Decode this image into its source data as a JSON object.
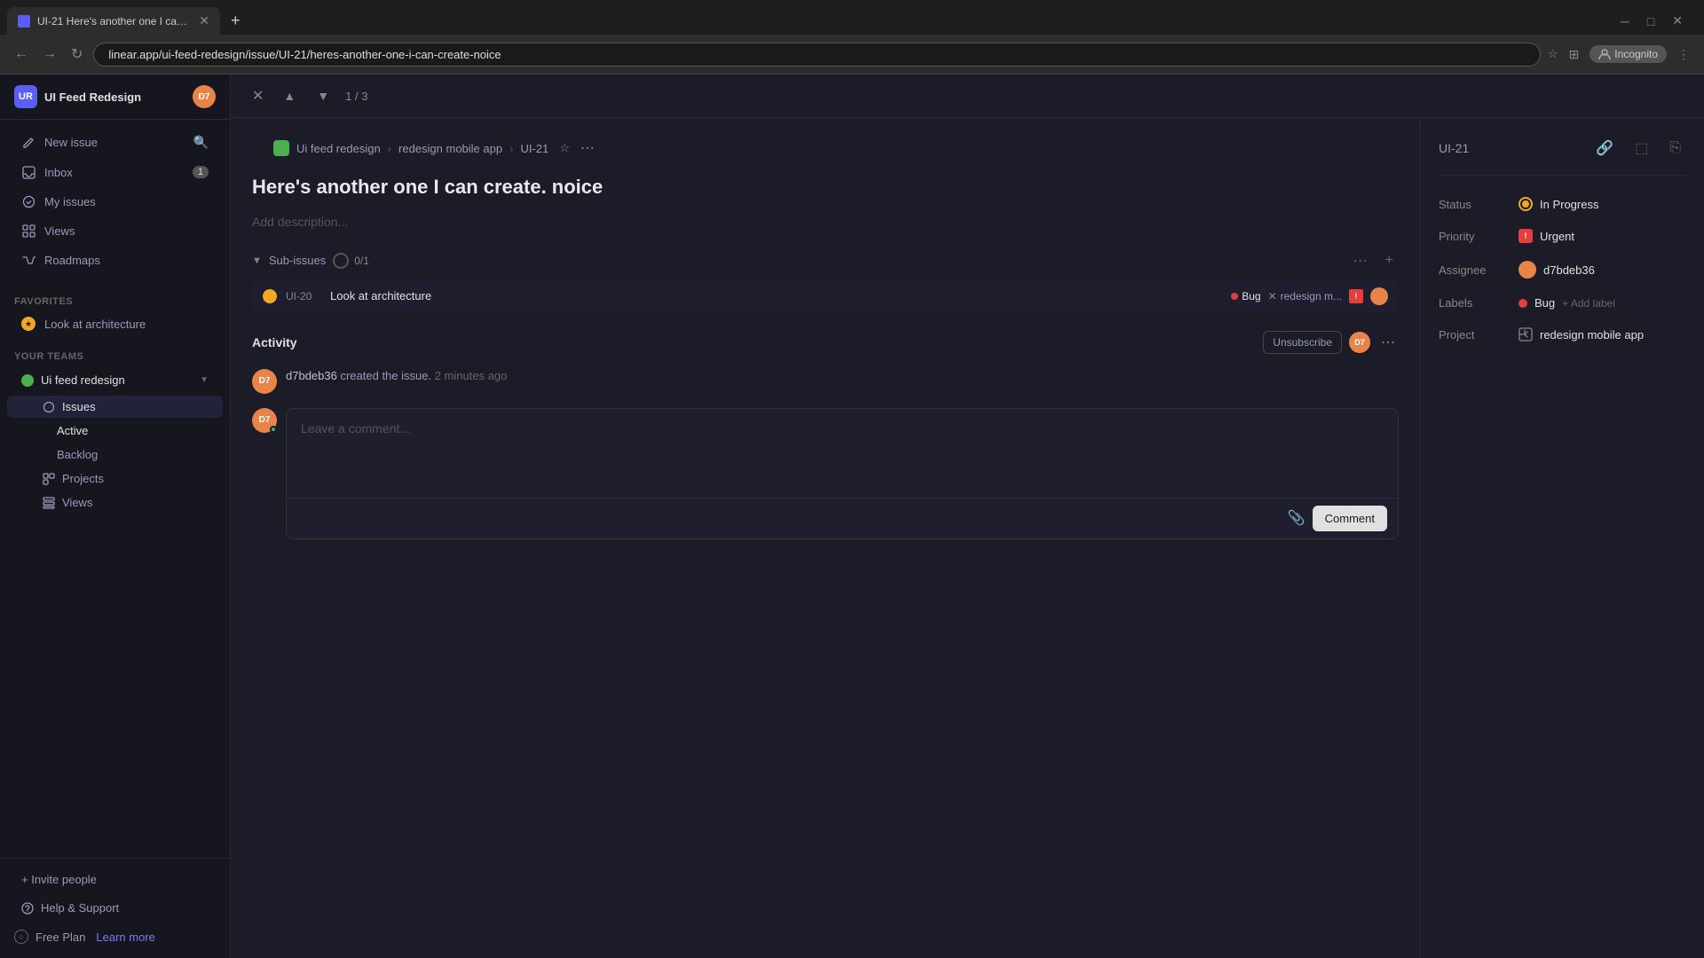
{
  "browser": {
    "tab_title": "UI-21 Here's another one I can c...",
    "tab_favicon": "U",
    "url": "linear.app/ui-feed-redesign/issue/UI-21/heres-another-one-i-can-create-noice",
    "add_tab_label": "+",
    "nav_back": "←",
    "nav_forward": "→",
    "refresh": "↻",
    "star": "☆",
    "incognito_label": "Incognito"
  },
  "sidebar": {
    "brand": {
      "initials": "UR",
      "name": "UI Feed Redesign"
    },
    "user_initials": "D7",
    "new_issue_label": "New issue",
    "search_label": "Search",
    "nav_items": [
      {
        "icon": "inbox-icon",
        "label": "Inbox",
        "badge": "1"
      },
      {
        "icon": "issues-icon",
        "label": "My issues",
        "badge": null
      },
      {
        "icon": "views-icon",
        "label": "Views",
        "badge": null
      },
      {
        "icon": "roadmap-icon",
        "label": "Roadmaps",
        "badge": null
      }
    ],
    "favorites_label": "Favorites",
    "favorites": [
      {
        "icon": "star-icon",
        "label": "Look at architecture"
      }
    ],
    "your_teams_label": "Your teams",
    "team": {
      "name": "Ui feed redesign",
      "subitems": [
        {
          "icon": "issues-sub-icon",
          "label": "Issues",
          "active": true,
          "subsubitems": [
            {
              "label": "Active",
              "active": true
            },
            {
              "label": "Backlog",
              "active": false
            }
          ]
        },
        {
          "icon": "projects-icon",
          "label": "Projects",
          "active": false
        },
        {
          "icon": "views-sub-icon",
          "label": "Views",
          "active": false
        }
      ]
    },
    "invite_label": "+ Invite people",
    "help_label": "Help & Support",
    "plan_label": "Free Plan",
    "upgrade_label": "Learn more"
  },
  "issue_toolbar": {
    "close": "✕",
    "prev": "▲",
    "next": "▼",
    "counter": "1 / 3"
  },
  "breadcrumb": {
    "team": "Ui feed redesign",
    "project": "redesign mobile app",
    "issue_id": "UI-21",
    "more": "⋯",
    "star": "☆"
  },
  "issue": {
    "id": "UI-21",
    "title": "Here's another one I can create. noice",
    "description_placeholder": "Add description...",
    "subissues": {
      "label": "Sub-issues",
      "progress": "0/1",
      "items": [
        {
          "id": "UI-20",
          "title": "Look at architecture",
          "bug_label": "Bug",
          "project_label": "redesign m...",
          "priority": "!"
        }
      ]
    }
  },
  "activity": {
    "label": "Activity",
    "unsubscribe_label": "Unsubscribe",
    "user_initials": "D7",
    "events": [
      {
        "author": "d7bdeb36",
        "action": "created the issue.",
        "time": "2 minutes ago"
      }
    ],
    "comment_placeholder": "Leave a comment...",
    "comment_button": "Comment",
    "attach_icon": "📎"
  },
  "properties": {
    "issue_id": "UI-21",
    "status_label": "Status",
    "status_value": "In Progress",
    "priority_label": "Priority",
    "priority_value": "Urgent",
    "assignee_label": "Assignee",
    "assignee_value": "d7bdeb36",
    "labels_label": "Labels",
    "labels_value": "Bug",
    "add_label": "+ Add label",
    "project_label": "Project",
    "project_value": "redesign mobile app"
  }
}
